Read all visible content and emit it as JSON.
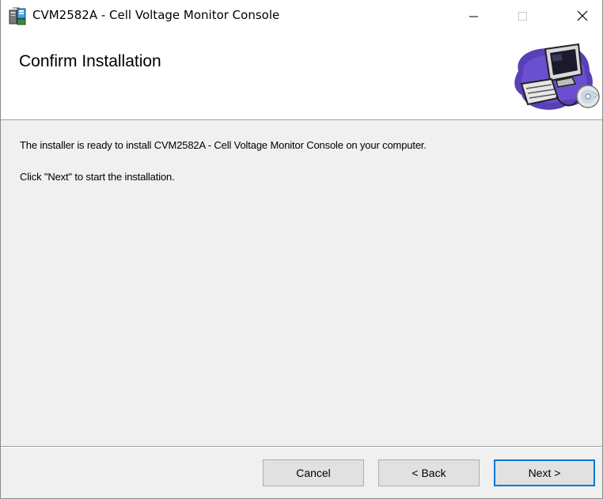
{
  "window": {
    "title": "CVM2582A - Cell Voltage Monitor Console"
  },
  "banner": {
    "title": "Confirm Installation"
  },
  "content": {
    "line1": "The installer is ready to install CVM2582A - Cell Voltage Monitor Console on your computer.",
    "line2": "Click \"Next\" to start the installation."
  },
  "buttons": {
    "cancel": "Cancel",
    "back": "< Back",
    "next": "Next >"
  },
  "colors": {
    "focus_border": "#0078d7",
    "dialog_bg": "#f0f0f0"
  }
}
